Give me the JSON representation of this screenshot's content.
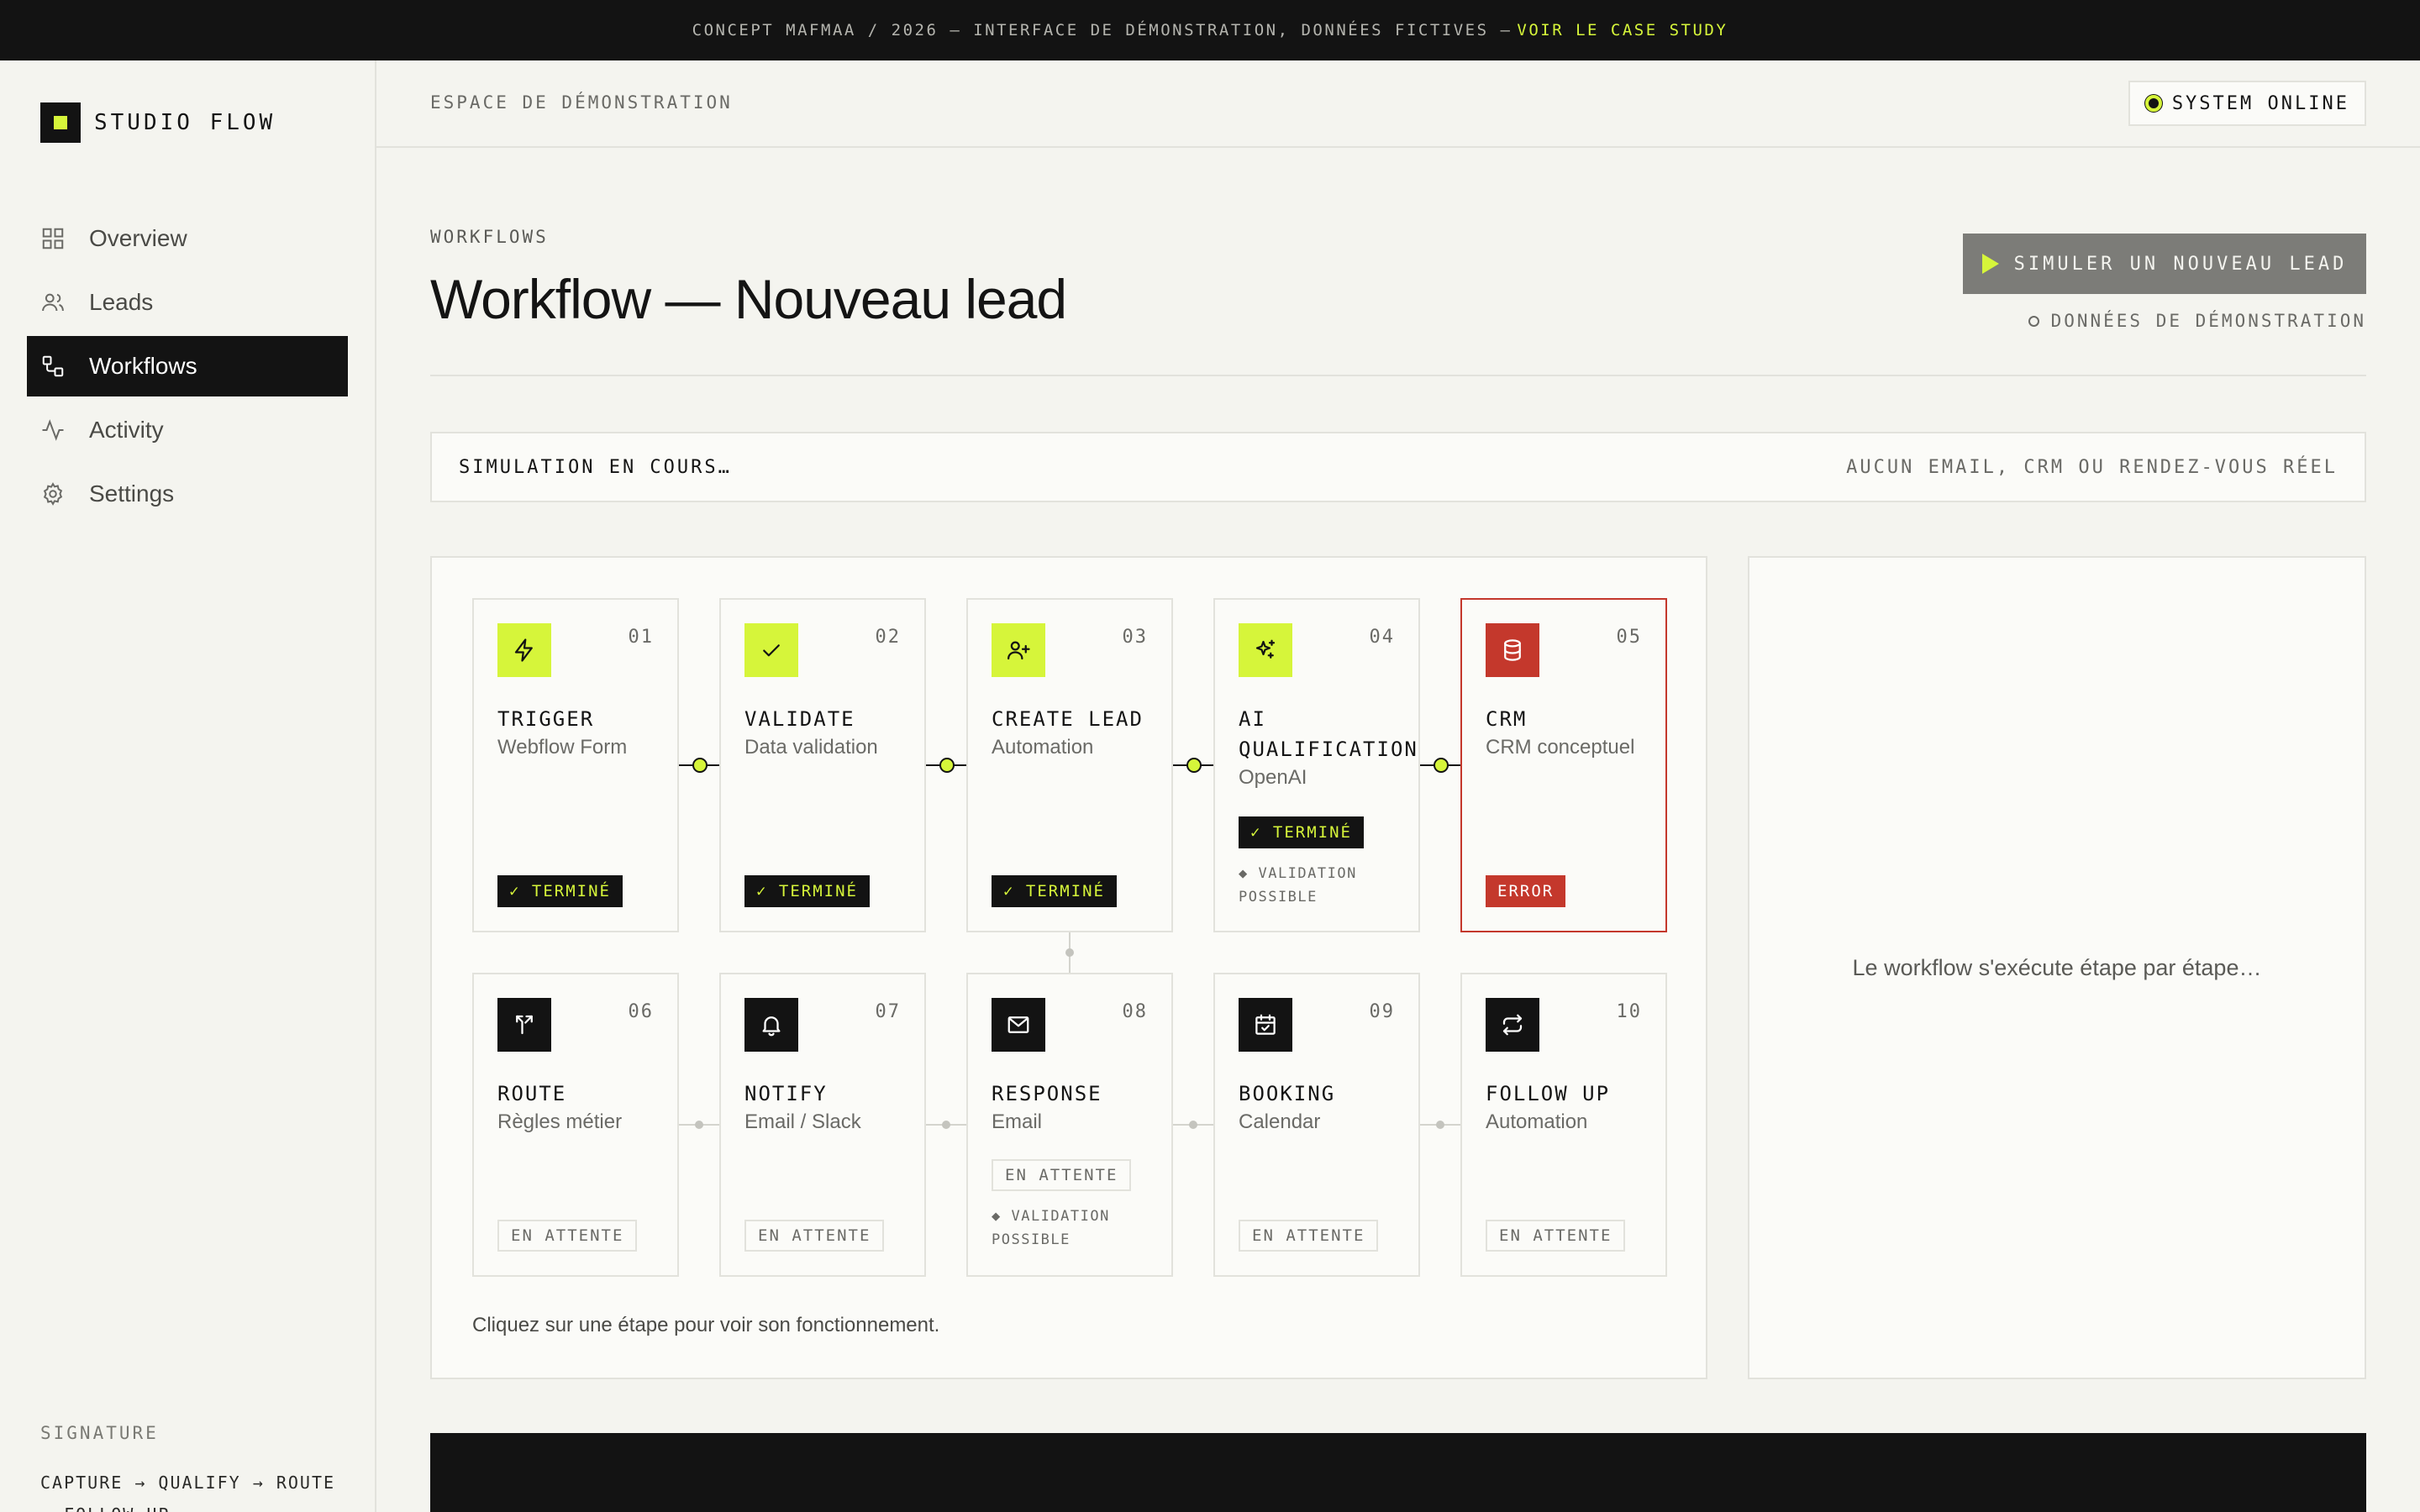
{
  "banner": {
    "text": "CONCEPT MAFMAA / 2026 — INTERFACE DE DÉMONSTRATION, DONNÉES FICTIVES —",
    "cta": "VOIR LE CASE STUDY"
  },
  "brand": {
    "name": "STUDIO FLOW"
  },
  "sidebar": {
    "items": [
      {
        "label": "Overview",
        "icon": "grid-icon"
      },
      {
        "label": "Leads",
        "icon": "users-icon"
      },
      {
        "label": "Workflows",
        "icon": "workflow-icon",
        "active": true
      },
      {
        "label": "Activity",
        "icon": "activity-icon"
      },
      {
        "label": "Settings",
        "icon": "gear-icon"
      }
    ],
    "signature_label": "SIGNATURE",
    "signature_text": "CAPTURE → QUALIFY → ROUTE → FOLLOW UP"
  },
  "header": {
    "label": "ESPACE DE DÉMONSTRATION",
    "status": "SYSTEM ONLINE"
  },
  "main": {
    "eyebrow": "WORKFLOWS",
    "title": "Workflow — Nouveau lead",
    "simulate_button": "SIMULER UN NOUVEAU LEAD",
    "demo_note": "DONNÉES DE DÉMONSTRATION",
    "sim_status": "SIMULATION EN COURS…",
    "sim_disclaimer": "AUCUN EMAIL, CRM OU RENDEZ-VOUS RÉEL",
    "log_placeholder": "Le workflow s'exécute étape par étape…",
    "footer_hint": "Cliquez sur une étape pour voir son fonctionnement."
  },
  "steps": [
    {
      "num": "01",
      "title": "TRIGGER",
      "sub": "Webflow Form",
      "status": "✓ TERMINÉ",
      "icon": "bolt-icon"
    },
    {
      "num": "02",
      "title": "VALIDATE",
      "sub": "Data validation",
      "status": "✓ TERMINÉ",
      "icon": "check-icon"
    },
    {
      "num": "03",
      "title": "CREATE LEAD",
      "sub": "Automation",
      "status": "✓ TERMINÉ",
      "icon": "user-plus-icon"
    },
    {
      "num": "04",
      "title": "AI QUALIFICATION",
      "sub": "OpenAI",
      "status": "✓ TERMINÉ",
      "hint": "◆ VALIDATION POSSIBLE",
      "icon": "sparkles-icon"
    },
    {
      "num": "05",
      "title": "CRM",
      "sub": "CRM conceptuel",
      "status": "ERROR",
      "icon": "database-icon"
    },
    {
      "num": "06",
      "title": "ROUTE",
      "sub": "Règles métier",
      "status": "EN ATTENTE",
      "icon": "split-icon"
    },
    {
      "num": "07",
      "title": "NOTIFY",
      "sub": "Email / Slack",
      "status": "EN ATTENTE",
      "icon": "bell-icon"
    },
    {
      "num": "08",
      "title": "RESPONSE",
      "sub": "Email",
      "status": "EN ATTENTE",
      "hint": "◆ VALIDATION POSSIBLE",
      "icon": "mail-icon"
    },
    {
      "num": "09",
      "title": "BOOKING",
      "sub": "Calendar",
      "status": "EN ATTENTE",
      "icon": "calendar-icon"
    },
    {
      "num": "10",
      "title": "FOLLOW UP",
      "sub": "Automation",
      "status": "EN ATTENTE",
      "icon": "repeat-icon"
    }
  ],
  "colors": {
    "accent": "#d6f53a",
    "dark": "#131313",
    "error": "#c4382c",
    "background": "#f4f4ef"
  }
}
